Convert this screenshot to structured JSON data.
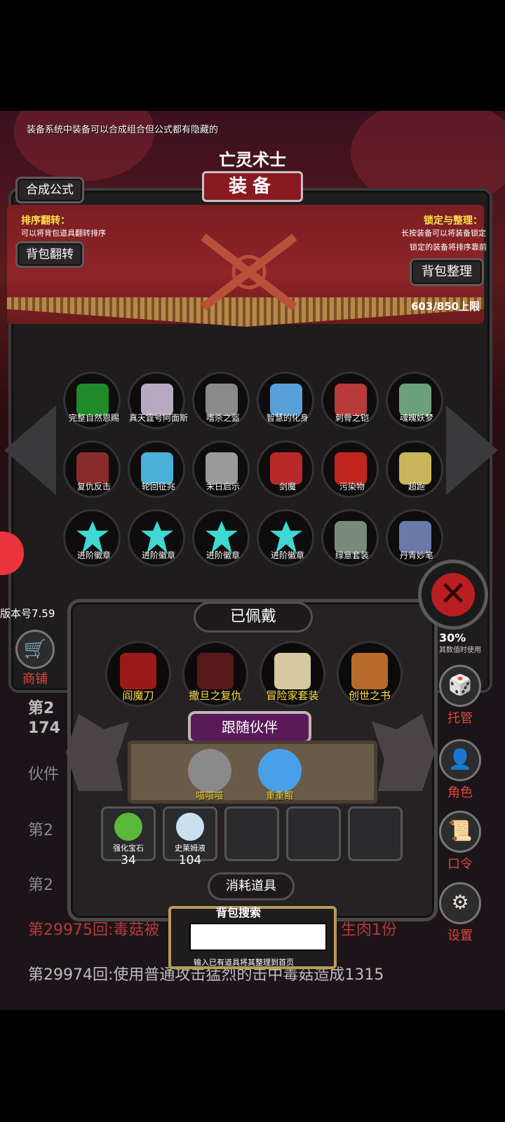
{
  "top_hint": "装备系统中装备可以合成组合但公式都有隐藏的",
  "title": {
    "sub": "亡灵术士",
    "main": "装备"
  },
  "buttons": {
    "synthesis_formula": "合成公式",
    "bag_flip": "背包翻转",
    "bag_organize": "背包整理"
  },
  "left_info": {
    "title": "排序翻转：",
    "desc": "可以将背包道具翻转排序"
  },
  "right_info": {
    "title": "锁定与整理：",
    "line1": "长按装备可以将装备锁定",
    "line2": "锁定的装备将排序靠前"
  },
  "capacity": "603/850上限",
  "items": [
    {
      "name": "完整自然恩赐",
      "color": "#1e8a2a"
    },
    {
      "name": "真天霆号阿面斯",
      "color": "#b8a8c0"
    },
    {
      "name": "嗜杀之盔",
      "color": "#8a8a8a"
    },
    {
      "name": "智慧的化身",
      "color": "#5aa0d8"
    },
    {
      "name": "刺骨之铠",
      "color": "#b83a3a"
    },
    {
      "name": "魂魄妖梦",
      "color": "#6aa07a"
    },
    {
      "name": "复仇反击",
      "color": "#8a2a2a"
    },
    {
      "name": "轮回征兆",
      "color": "#4ab0d8"
    },
    {
      "name": "末日启示",
      "color": "#9a9a9a"
    },
    {
      "name": "剑魔",
      "color": "#b82a2a"
    },
    {
      "name": "污染物",
      "color": "#c0261e"
    },
    {
      "name": "超跑",
      "color": "#c8b45a"
    },
    {
      "name": "进阶徽章",
      "color": "#3fd8d2"
    },
    {
      "name": "进阶徽章",
      "color": "#3fd8d2"
    },
    {
      "name": "进阶徽章",
      "color": "#3fd8d2"
    },
    {
      "name": "进阶徽章",
      "color": "#3fd8d2"
    },
    {
      "name": "绿意套装",
      "color": "#7a8a7a"
    },
    {
      "name": "丹青妙笔",
      "color": "#6a7aa8"
    }
  ],
  "version": "版本号7.59",
  "percent": "30%",
  "percent_sub": "其数值时使用",
  "log": {
    "l1": "第2",
    "l2": "174",
    "l3": "伙件",
    "l4": "第2",
    "l5": "第2",
    "l6": "第29975回:毒菇被",
    "l6b": "生肉1份",
    "l7": "第29974回:使用普通攻击猛烈的击中毒菇造成1315"
  },
  "side_menu": [
    {
      "label": "商铺",
      "icon": "🛒"
    },
    {
      "label": "托管",
      "icon": "🎲"
    },
    {
      "label": "角色",
      "icon": "👤"
    },
    {
      "label": "口令",
      "icon": "📜"
    },
    {
      "label": "设置",
      "icon": "⚙"
    }
  ],
  "equipped": {
    "title": "已佩戴",
    "gear": [
      {
        "name": "阎魔刀",
        "color": "#9a1a1a"
      },
      {
        "name": "撒旦之复仇",
        "color": "#5a1a1a"
      },
      {
        "name": "冒险家套装",
        "color": "#d8c8a0"
      },
      {
        "name": "创世之书",
        "color": "#b86a2a"
      }
    ]
  },
  "partners": {
    "title": "跟随伙伴",
    "list": [
      {
        "name": "喵喵喵",
        "color": "#8a8a8a"
      },
      {
        "name": "重重鲲",
        "color": "#4aa0e8"
      }
    ]
  },
  "consumables": {
    "title": "消耗道具",
    "list": [
      {
        "name": "强化宝石",
        "count": "34",
        "color": "#5ab83a"
      },
      {
        "name": "史莱姆液",
        "count": "104",
        "color": "#c8e0f0"
      }
    ]
  },
  "search": {
    "label": "背包搜索",
    "hint": "输入已有道具将其整理到首页",
    "value": ""
  }
}
